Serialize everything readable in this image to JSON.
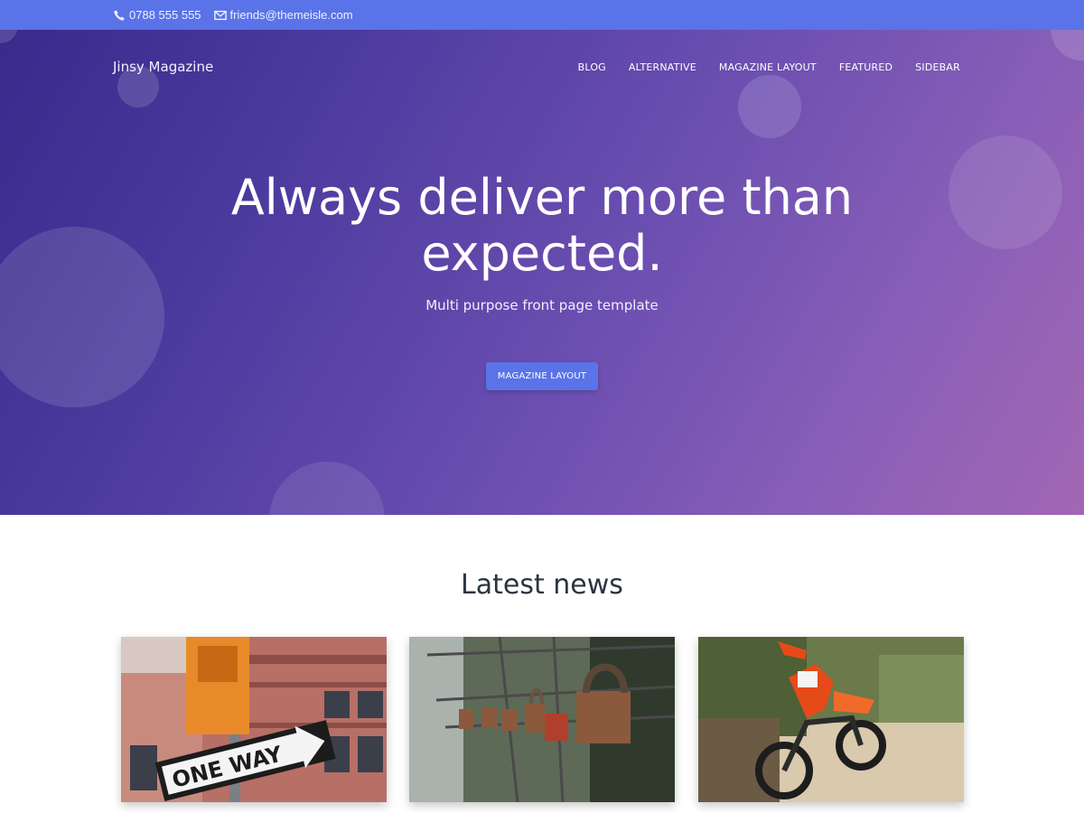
{
  "topbar": {
    "phone": "0788 555 555",
    "email": "friends@themeisle.com",
    "phone_icon": "phone-icon",
    "email_icon": "envelope-icon",
    "background": "#5a73e8"
  },
  "header": {
    "brand": "Jinsy Magazine",
    "nav": [
      "BLOG",
      "ALTERNATIVE",
      "MAGAZINE LAYOUT",
      "FEATURED",
      "SIDEBAR"
    ]
  },
  "hero": {
    "headline": "Always deliver more than expected.",
    "subheadline": "Multi purpose front page template",
    "button_label": "MAGAZINE LAYOUT",
    "gradient_start": "#3a2a8c",
    "gradient_end": "#a267b4",
    "button_color": "#5a73e8"
  },
  "latest_news": {
    "title": "Latest news",
    "cards": [
      {
        "image": "one-way-street-sign-photo",
        "sign_text": "ONE WAY"
      },
      {
        "image": "love-padlocks-photo"
      },
      {
        "image": "dirt-bike-photo"
      }
    ]
  }
}
